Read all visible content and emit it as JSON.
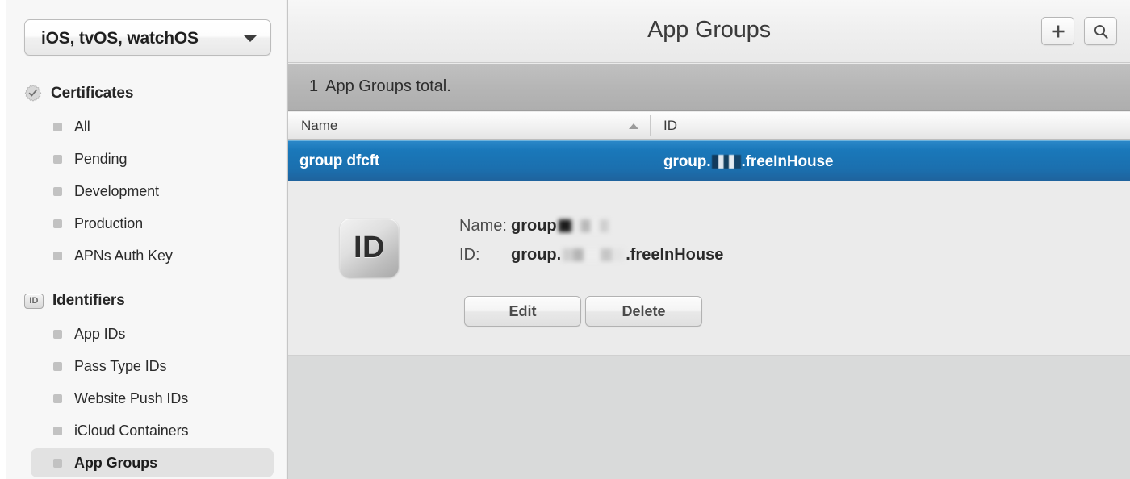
{
  "sidebar": {
    "platform_select": {
      "value": "iOS, tvOS, watchOS",
      "arrow_icon": "chevron-down-icon"
    },
    "groups": [
      {
        "icon": "certificate-seal-icon",
        "label": "Certificates",
        "items": [
          {
            "label": "All",
            "selected": false
          },
          {
            "label": "Pending",
            "selected": false
          },
          {
            "label": "Development",
            "selected": false
          },
          {
            "label": "Production",
            "selected": false
          },
          {
            "label": "APNs Auth Key",
            "selected": false
          }
        ]
      },
      {
        "icon": "id-badge-icon",
        "icon_text": "ID",
        "label": "Identifiers",
        "items": [
          {
            "label": "App IDs",
            "selected": false
          },
          {
            "label": "Pass Type IDs",
            "selected": false
          },
          {
            "label": "Website Push IDs",
            "selected": false
          },
          {
            "label": "iCloud Containers",
            "selected": false
          },
          {
            "label": "App Groups",
            "selected": true
          }
        ]
      }
    ]
  },
  "header": {
    "title": "App Groups",
    "add_button": {
      "icon": "plus-icon",
      "label": "+"
    },
    "search_button": {
      "icon": "search-icon",
      "label": ""
    }
  },
  "status_bar": {
    "count": "1",
    "text": "App Groups total."
  },
  "table": {
    "columns": [
      {
        "key": "name",
        "label": "Name",
        "sorted": "ascending",
        "sort_icon": "sort-ascending-icon"
      },
      {
        "key": "id",
        "label": "ID",
        "sorted": "none"
      }
    ],
    "rows": [
      {
        "name": "group dfcft",
        "id_prefix": "group.",
        "id_redacted": true,
        "id_suffix": ".freeInHouse",
        "selected": true
      }
    ]
  },
  "detail": {
    "icon": "id-app-group-icon",
    "icon_text": "ID",
    "fields": [
      {
        "label": "Name:",
        "value_prefix": "group",
        "redacted": true,
        "value_suffix": ""
      },
      {
        "label": "ID:",
        "value_prefix": "group.",
        "redacted": true,
        "value_suffix": ".freeInHouse"
      }
    ],
    "buttons": [
      {
        "name": "edit",
        "label": "Edit"
      },
      {
        "name": "delete",
        "label": "Delete"
      }
    ]
  },
  "colors": {
    "selection_blue": "#1a78ba",
    "sidebar_bg": "#f7f7f7",
    "panel_bg": "#ebebeb",
    "status_bar_bg": "#b5b5b5",
    "empty_bg": "#d9dada"
  }
}
